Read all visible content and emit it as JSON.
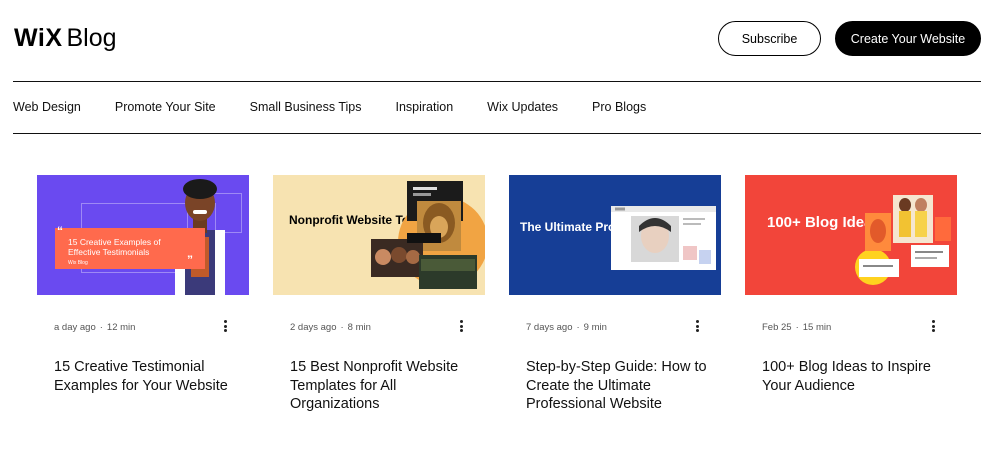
{
  "header": {
    "logo_wix": "WiX",
    "logo_blog": "Blog",
    "subscribe_label": "Subscribe",
    "create_label": "Create Your Website"
  },
  "nav": {
    "items": [
      {
        "label": "Web Design"
      },
      {
        "label": "Promote Your Site"
      },
      {
        "label": "Small Business Tips"
      },
      {
        "label": "Inspiration"
      },
      {
        "label": "Wix Updates"
      },
      {
        "label": "Pro Blogs"
      }
    ]
  },
  "posts": [
    {
      "date": "a day ago",
      "read_time": "12 min",
      "title": "15 Creative Testimonial Examples for Your Website",
      "thumb_text": "15 Creative Examples of Effective Testimonials",
      "thumb_sub": "Wix Blog",
      "thumb_color": "#6a4af0"
    },
    {
      "date": "2 days ago",
      "read_time": "8 min",
      "title": "15 Best Nonprofit Website Templates for All Organizations",
      "thumb_text": "Nonprofit Website Templates",
      "thumb_color": "#f7e3b1"
    },
    {
      "date": "7 days ago",
      "read_time": "9 min",
      "title": "Step-by-Step Guide: How to Create the Ultimate Professional Website",
      "thumb_text": "The Ultimate Pro Website",
      "thumb_color": "#163e96"
    },
    {
      "date": "Feb 25",
      "read_time": "15 min",
      "title": "100+ Blog Ideas to Inspire Your Audience",
      "thumb_text": "100+ Blog Ideas",
      "thumb_color": "#f2453a"
    }
  ]
}
